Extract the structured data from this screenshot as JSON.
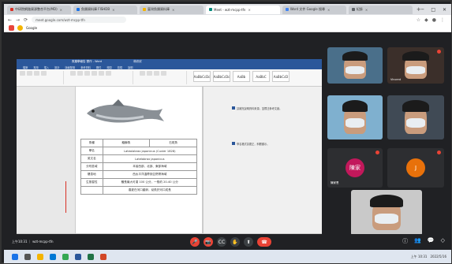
{
  "browser": {
    "tabs": [
      {
        "label": "中研院網路資源整合平台(MD)",
        "color": "#d93025",
        "active": false
      },
      {
        "label": "魚類資料庫 FISHDB",
        "color": "#1a73e8",
        "active": false
      },
      {
        "label": "臺灣魚類資料庫",
        "color": "#f4b400",
        "active": false
      },
      {
        "label": "Meet - wzt-mcpp-tfn",
        "color": "#00897b",
        "active": true
      },
      {
        "label": "Word 文件 Google 搜尋",
        "color": "#4285f4",
        "active": false
      },
      {
        "label": "紀錄",
        "color": "#5f6368",
        "active": false
      }
    ],
    "new_tab": "+",
    "window_controls": [
      "─",
      "□",
      "✕"
    ],
    "nav": [
      "←",
      "→",
      "⟳"
    ],
    "url": "meet.google.com/wzt-mcpp-tfn",
    "bookmark_label": "Google"
  },
  "word": {
    "title": "魚類學報告 實作 - Word",
    "user": "林欣欣",
    "menu": [
      "檔案",
      "常用",
      "插入",
      "設計",
      "版面配置",
      "參考資料",
      "郵件",
      "校閱",
      "檢視",
      "說明"
    ],
    "styles": [
      "AaBbCcDc",
      "AaBbCcDc",
      "AaBb",
      "AaBbC",
      "AaBbCcD"
    ],
    "table": [
      [
        "魚種",
        "鯔鰤魚",
        "石斑魚"
      ],
      [
        "學名",
        "Lateolabrax japonicus (Cuvier 1828)",
        ""
      ],
      [
        "英文名",
        "Latelabrax japonicus",
        ""
      ],
      [
        "分布區域",
        "本省西部、北部、東部海域",
        ""
      ],
      [
        "棲息地",
        "西太平洋溫帶到亞熱帶海域",
        ""
      ],
      [
        "生態習性",
        "體長最大可達 100 公分，一般約 20-40 公分",
        ""
      ],
      [
        "",
        "春夏在河口產卵，幼魚於河口成長",
        ""
      ]
    ],
    "comments": [
      "請補充說明資料來源，並標註參考文獻。",
      "學名格式請更正，斜體顯示。"
    ]
  },
  "meet": {
    "participants": [
      {
        "name": "",
        "muted": false,
        "bg": "#4a6f8a"
      },
      {
        "name": "Vincent",
        "muted": true,
        "bg": "#3b2f2a"
      },
      {
        "name": "林明明",
        "muted": false,
        "bg": "#6f6a5c"
      },
      {
        "name": "",
        "muted": false,
        "bg": "#7fb0cf"
      },
      {
        "name": "",
        "muted": false,
        "bg": "#404a55"
      },
      {
        "name": "陳家恩",
        "initial": "陳家",
        "muted": true,
        "bg": "#2d2e31",
        "circle": "#c2185b"
      },
      {
        "name": "",
        "initial": "J",
        "muted": true,
        "bg": "#2d2e31",
        "circle": "#e8710a"
      },
      {
        "name": "",
        "muted": false,
        "bg": "#c9c9c9"
      }
    ],
    "meeting_code": "上午10:31 ｜ wzt-mcpp-tfn",
    "controls": [
      "🎤",
      "📷",
      "CC",
      "✋",
      "⬆",
      "⋮"
    ],
    "end_call": "☎",
    "right_controls": [
      "ⓘ",
      "👥",
      "💬",
      "◇"
    ]
  },
  "taskbar": {
    "time": "上午 10:31",
    "date": "2022/5/16"
  }
}
